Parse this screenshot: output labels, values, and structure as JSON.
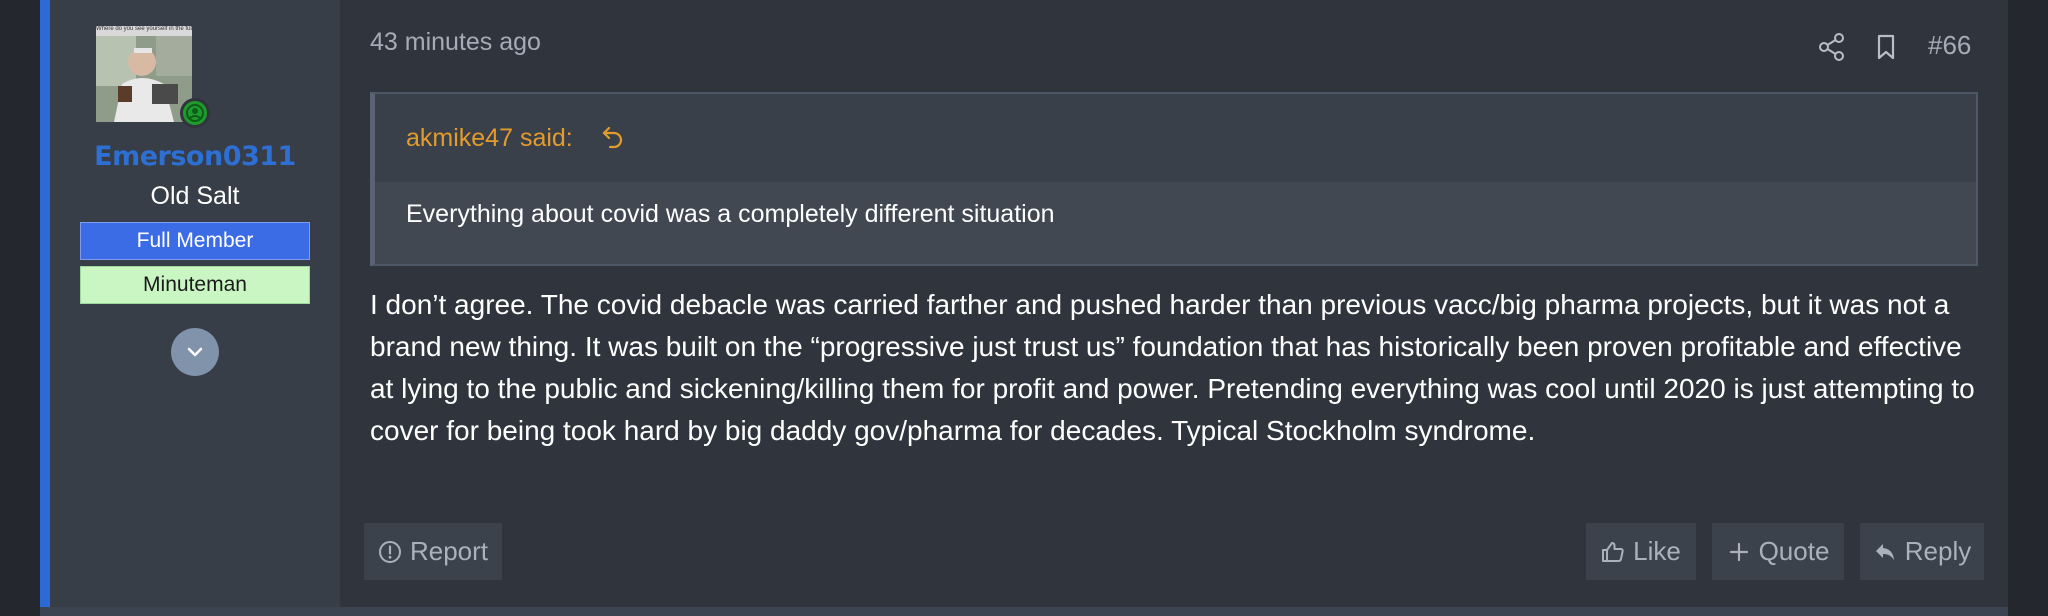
{
  "user": {
    "name": "Emerson0311",
    "title": "Old Salt",
    "banners": [
      "Full Member",
      "Minuteman"
    ],
    "avatar_caption": "Where do you see yourself in the future",
    "online_icon": "user-circle-icon",
    "expand_icon": "chevron-down-icon"
  },
  "post": {
    "timestamp": "43 minutes ago",
    "number": "#66",
    "quote": {
      "author_label": "akmike47 said:",
      "text": "Everything about covid was a completely different situation"
    },
    "body": "I don’t agree. The covid debacle was carried farther and pushed harder than previous vacc/big pharma projects, but it was not a brand new thing. It was built on the “progressive just trust us” foundation that has historically been proven profitable and effective at lying to the public and sickening/killing them for profit and power. Pretending everything was cool until 2020 is just attempting to cover for being took hard by big daddy gov/pharma for decades. Typical Stockholm syndrome."
  },
  "actions": {
    "report": "Report",
    "like": "Like",
    "quote": "Quote",
    "reply": "Reply"
  },
  "colors": {
    "accent": "#2c6ad5",
    "username": "#2e6fd3",
    "quote_author": "#e39b2c",
    "full_member_banner": "#3c6ce5",
    "minuteman_banner": "#c9f6c3",
    "online": "#1f9b2d"
  }
}
